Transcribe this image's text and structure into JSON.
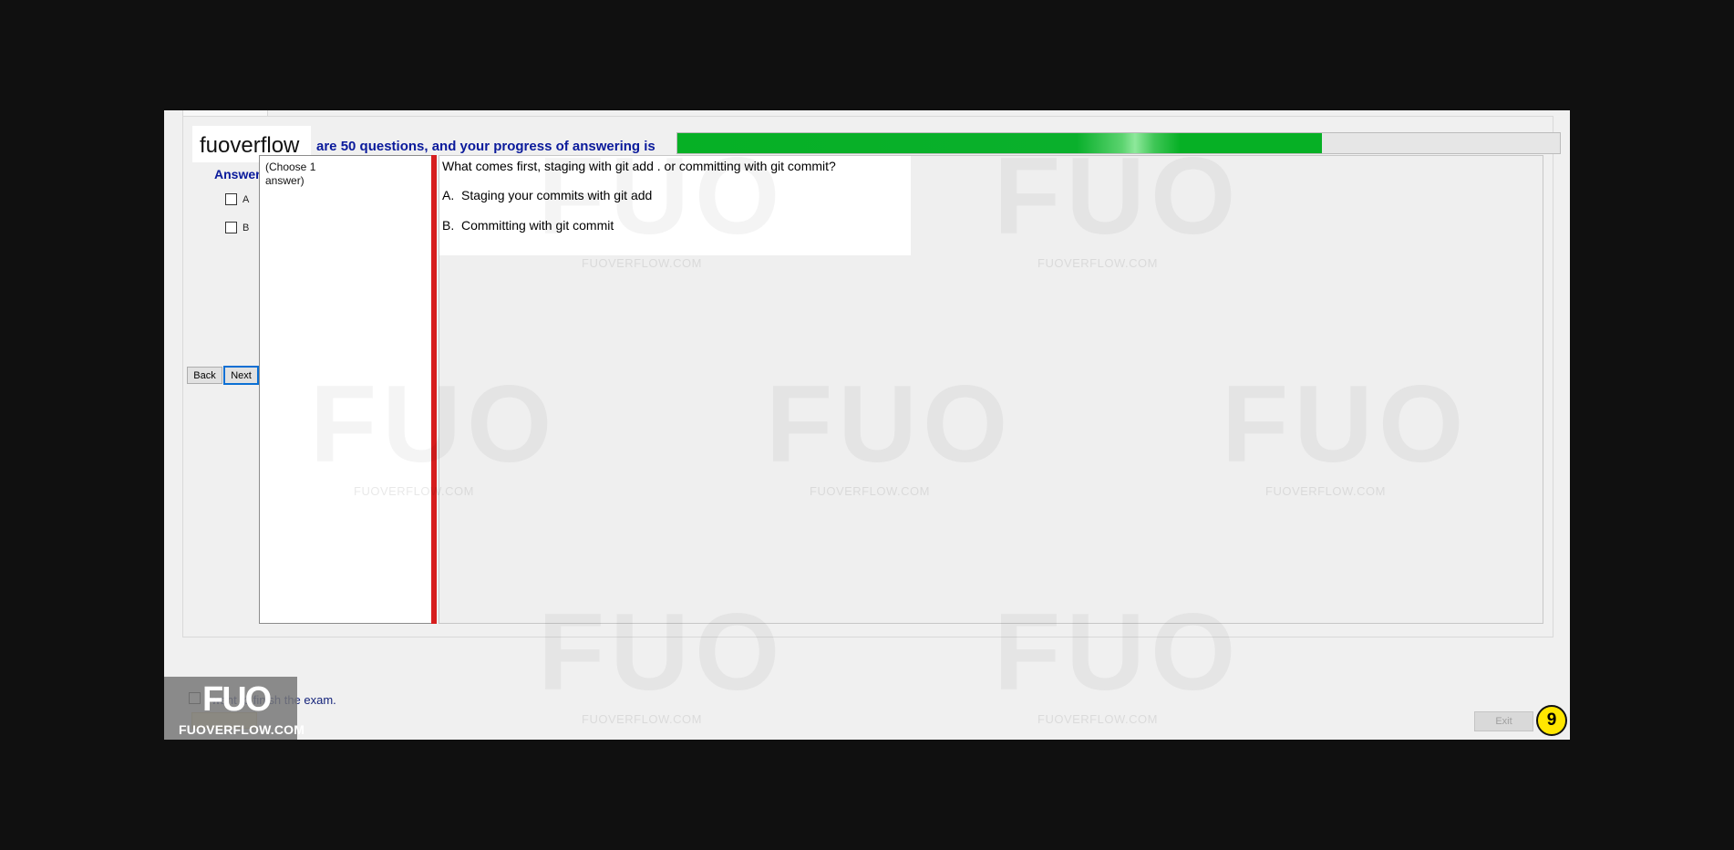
{
  "header": {
    "logo_text": "fuoverflow",
    "progress_text": "are 50 questions, and your progress of answering is",
    "progress_fraction": 0.73
  },
  "answer_panel": {
    "heading": "Answer",
    "options": [
      {
        "label": "A",
        "checked": false
      },
      {
        "label": "B",
        "checked": false
      }
    ],
    "back_label": "Back",
    "next_label": "Next"
  },
  "instruction": {
    "text": "(Choose 1 answer)"
  },
  "question": {
    "text": "What comes first, staging with git add . or committing with git commit?",
    "options": [
      {
        "letter": "A.",
        "text": "Staging your commits with git add"
      },
      {
        "letter": "B.",
        "text": "Committing with git commit"
      }
    ]
  },
  "footer": {
    "finish_label": "I want to finish the exam.",
    "brand_mark": "FUO",
    "brand_text": "FUOVERFLOW.COM",
    "exit_label": "Exit",
    "counter": "9"
  },
  "watermark": {
    "word": "FUO",
    "caption": "FUOVERFLOW.COM"
  },
  "colors": {
    "progress_green": "#06b025",
    "label_blue": "#0a1a9b",
    "divider_red": "#d61e1e",
    "counter_yellow": "#ffe600",
    "focus_blue": "#0a6fd4"
  }
}
